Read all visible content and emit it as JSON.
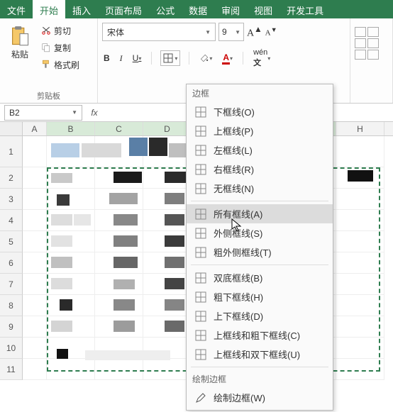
{
  "tabs": {
    "file": "文件",
    "home": "开始",
    "insert": "插入",
    "layout": "页面布局",
    "formula": "公式",
    "data": "数据",
    "review": "审阅",
    "view": "视图",
    "dev": "开发工具"
  },
  "ribbon": {
    "paste": "粘贴",
    "cut": "剪切",
    "copy": "复制",
    "format_painter": "格式刷",
    "clipboard_title": "剪贴板",
    "font_name": "宋体",
    "font_size": "9"
  },
  "namebox": "B2",
  "grid": {
    "cols": [
      "A",
      "B",
      "C",
      "D",
      "",
      "",
      "",
      "H"
    ],
    "rows": [
      "1",
      "2",
      "3",
      "4",
      "5",
      "6",
      "7",
      "8",
      "9",
      "10",
      "11"
    ]
  },
  "menu": {
    "title": "边框",
    "items": [
      {
        "label": "下框线(O)"
      },
      {
        "label": "上框线(P)"
      },
      {
        "label": "左框线(L)"
      },
      {
        "label": "右框线(R)"
      },
      {
        "label": "无框线(N)"
      },
      {
        "label": "所有框线(A)",
        "hover": true
      },
      {
        "label": "外侧框线(S)"
      },
      {
        "label": "粗外侧框线(T)"
      },
      {
        "label": "双底框线(B)"
      },
      {
        "label": "粗下框线(H)"
      },
      {
        "label": "上下框线(D)"
      },
      {
        "label": "上框线和粗下框线(C)"
      },
      {
        "label": "上框线和双下框线(U)"
      }
    ],
    "section2": "绘制边框",
    "draw": "绘制边框(W)"
  }
}
